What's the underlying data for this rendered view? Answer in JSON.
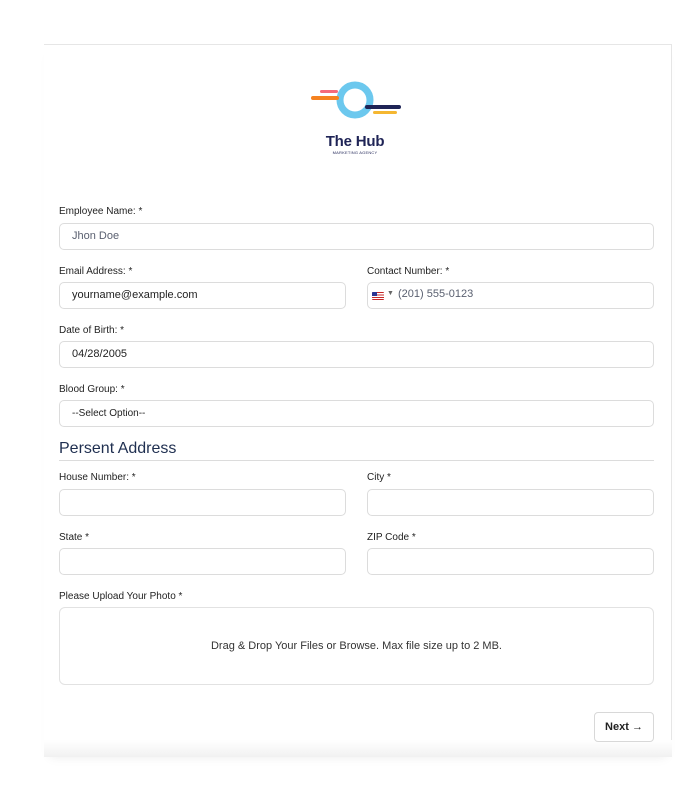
{
  "brand": {
    "name": "The Hub",
    "tagline": "MARKETING AGENCY",
    "colors": {
      "navy": "#1f2456",
      "sky": "#6cc8ee",
      "orange": "#f58220",
      "pink": "#f46a7b",
      "yellow": "#f5b731"
    }
  },
  "form": {
    "employee_name": {
      "label": "Employee Name: *",
      "value": "Jhon Doe"
    },
    "email": {
      "label": "Email Address: *",
      "value": "yourname@example.com"
    },
    "contact": {
      "label": "Contact Number: *",
      "flag": "us-flag-icon",
      "value": "(201) 555-0123"
    },
    "dob": {
      "label": "Date of Birth: *",
      "value": "04/28/2005"
    },
    "blood_group": {
      "label": "Blood Group: *",
      "selected": "--Select Option--"
    },
    "address_section": {
      "title": "Persent Address",
      "house_number": {
        "label": "House Number: *",
        "value": ""
      },
      "city": {
        "label": "City *",
        "value": ""
      },
      "state": {
        "label": "State *",
        "value": ""
      },
      "zip": {
        "label": "ZIP Code *",
        "value": ""
      }
    },
    "photo": {
      "label": "Please Upload Your Photo *",
      "dropzone_text": "Drag & Drop Your Files or Browse. Max file size up to 2 MB."
    },
    "next_label": "Next →"
  }
}
